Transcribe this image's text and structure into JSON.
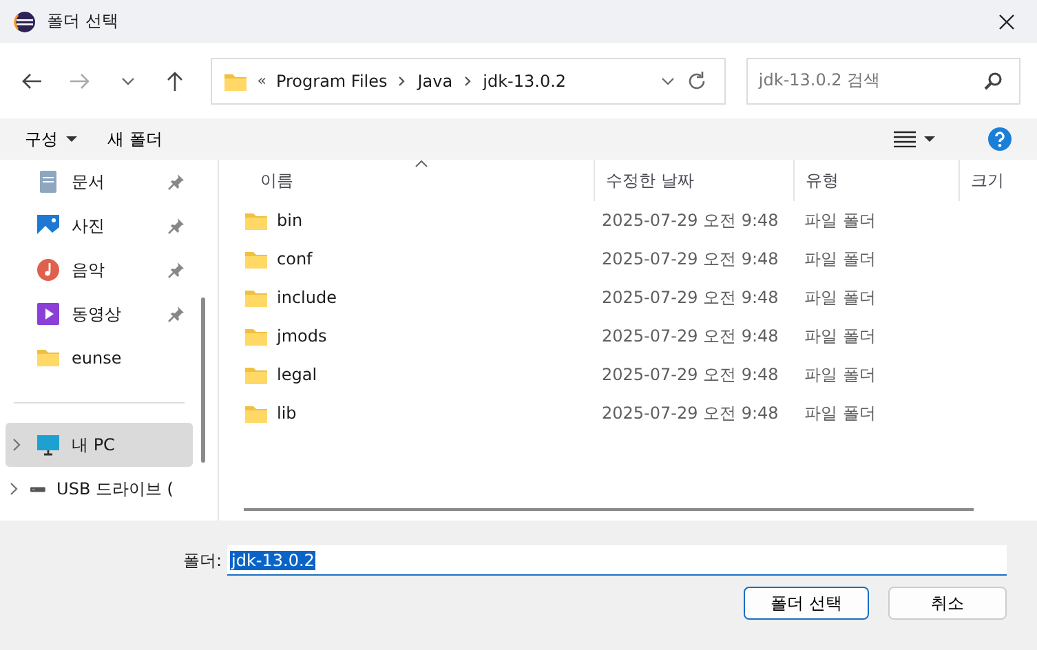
{
  "window": {
    "title": "폴더 선택"
  },
  "address": {
    "overflow": "«",
    "crumbs": [
      "Program Files",
      "Java",
      "jdk-13.0.2"
    ]
  },
  "search": {
    "placeholder": "jdk-13.0.2 검색"
  },
  "toolbar": {
    "organize": "구성",
    "new_folder": "새 폴더"
  },
  "sidebar": {
    "items": [
      {
        "label": "문서",
        "kind": "documents",
        "pinned": true,
        "selected": false,
        "expandable": false
      },
      {
        "label": "사진",
        "kind": "pictures",
        "pinned": true,
        "selected": false,
        "expandable": false
      },
      {
        "label": "음악",
        "kind": "music",
        "pinned": true,
        "selected": false,
        "expandable": false
      },
      {
        "label": "동영상",
        "kind": "videos",
        "pinned": true,
        "selected": false,
        "expandable": false
      },
      {
        "label": "eunse",
        "kind": "folder",
        "pinned": false,
        "selected": false,
        "expandable": false
      },
      {
        "label": "내 PC",
        "kind": "pc",
        "pinned": false,
        "selected": true,
        "expandable": true
      },
      {
        "label": "USB 드라이브 (",
        "kind": "drive",
        "pinned": false,
        "selected": false,
        "expandable": true
      }
    ]
  },
  "table": {
    "columns": [
      "이름",
      "수정한 날짜",
      "유형",
      "크기"
    ],
    "rows": [
      {
        "name": "bin",
        "modified": "2025-07-29 오전 9:48",
        "type": "파일 폴더"
      },
      {
        "name": "conf",
        "modified": "2025-07-29 오전 9:48",
        "type": "파일 폴더"
      },
      {
        "name": "include",
        "modified": "2025-07-29 오전 9:48",
        "type": "파일 폴더"
      },
      {
        "name": "jmods",
        "modified": "2025-07-29 오전 9:48",
        "type": "파일 폴더"
      },
      {
        "name": "legal",
        "modified": "2025-07-29 오전 9:48",
        "type": "파일 폴더"
      },
      {
        "name": "lib",
        "modified": "2025-07-29 오전 9:48",
        "type": "파일 폴더"
      }
    ]
  },
  "folder_field": {
    "label": "폴더:",
    "value": "jdk-13.0.2"
  },
  "buttons": [
    "폴더 선택",
    "취소"
  ]
}
